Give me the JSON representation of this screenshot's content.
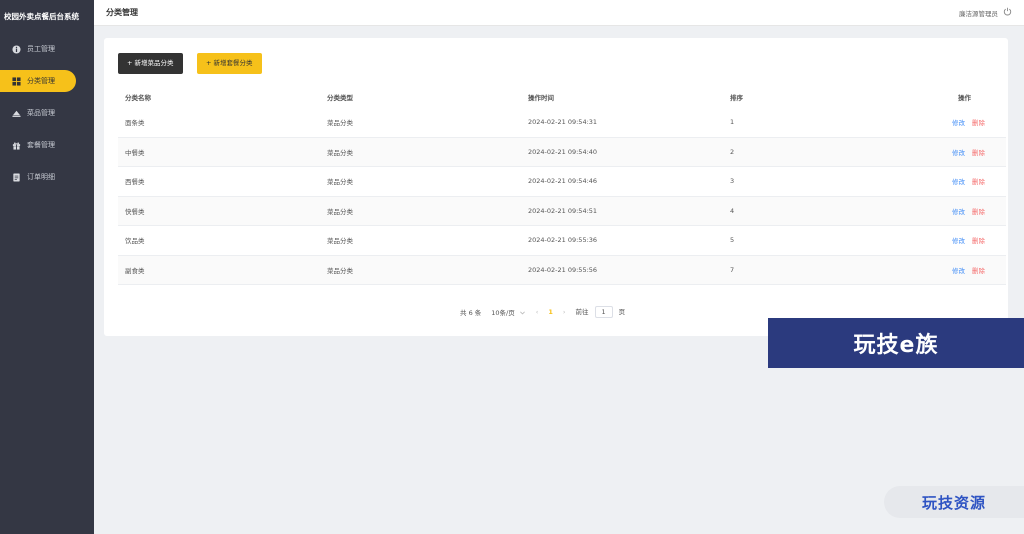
{
  "brand": "校园外卖点餐后台系统",
  "sidebar": {
    "items": [
      {
        "label": "员工管理",
        "icon": "info-icon"
      },
      {
        "label": "分类管理",
        "icon": "grid-icon",
        "active": true
      },
      {
        "label": "菜品管理",
        "icon": "dish-icon"
      },
      {
        "label": "套餐管理",
        "icon": "gift-icon"
      },
      {
        "label": "订单明细",
        "icon": "document-icon"
      }
    ]
  },
  "header": {
    "title": "分类管理",
    "user": "廉洁源管理员",
    "logout_icon": "power-icon"
  },
  "toolbar": {
    "add_dish_category": "+ 新增菜品分类",
    "add_combo_category": "+ 新增套餐分类"
  },
  "table": {
    "columns": [
      "分类名称",
      "分类类型",
      "操作时间",
      "排序",
      "操作"
    ],
    "rows": [
      {
        "name": "面条类",
        "type": "菜品分类",
        "time": "2024-02-21 09:54:31",
        "sort": "1"
      },
      {
        "name": "中餐类",
        "type": "菜品分类",
        "time": "2024-02-21 09:54:40",
        "sort": "2"
      },
      {
        "name": "西餐类",
        "type": "菜品分类",
        "time": "2024-02-21 09:54:46",
        "sort": "3"
      },
      {
        "name": "快餐类",
        "type": "菜品分类",
        "time": "2024-02-21 09:54:51",
        "sort": "4"
      },
      {
        "name": "饮品类",
        "type": "菜品分类",
        "time": "2024-02-21 09:55:36",
        "sort": "5"
      },
      {
        "name": "副食类",
        "type": "菜品分类",
        "time": "2024-02-21 09:55:56",
        "sort": "7"
      }
    ],
    "edit_label": "修改",
    "delete_label": "删除"
  },
  "pagination": {
    "total": "共 6 条",
    "page_size": "10条/页",
    "prev": "‹",
    "current": "1",
    "next": "›",
    "goto_label": "前往",
    "goto_value": "1",
    "page_suffix": "页"
  },
  "watermarks": {
    "banner": "玩技e族",
    "corner": "玩技资源"
  },
  "colors": {
    "sidebar": "#343744",
    "accent": "#f6c11a",
    "link": "#418df7",
    "danger": "#f56c6c"
  }
}
